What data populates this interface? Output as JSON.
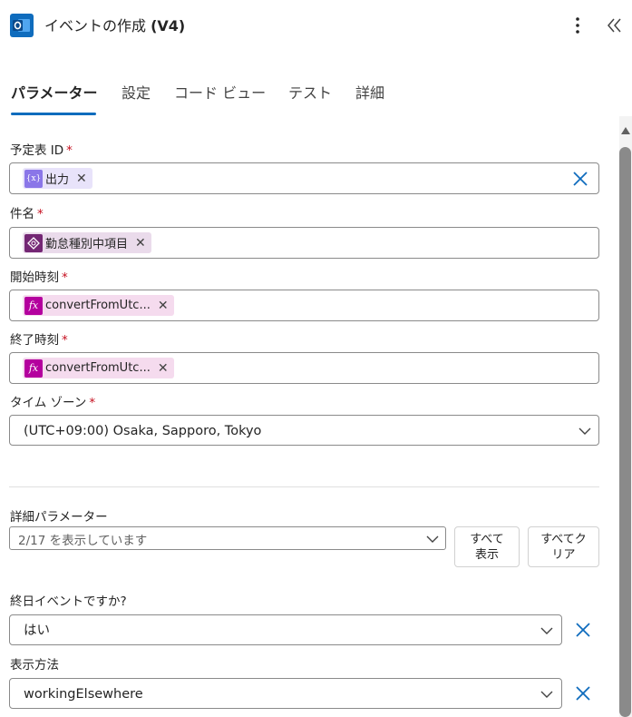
{
  "header": {
    "title_prefix": "イベントの作成 ",
    "title_version": "(V4)",
    "app_icon": "outlook-icon",
    "more_icon": "more-vertical-icon",
    "collapse_icon": "chevron-double-left-icon"
  },
  "tabs": [
    {
      "label": "パラメーター",
      "active": true
    },
    {
      "label": "設定",
      "active": false
    },
    {
      "label": "コード ビュー",
      "active": false
    },
    {
      "label": "テスト",
      "active": false
    },
    {
      "label": "詳細",
      "active": false
    }
  ],
  "fields": {
    "calendar_id": {
      "label": "予定表 ID",
      "required": "*",
      "token": "出力",
      "token_icon": "expression-variable-icon"
    },
    "subject": {
      "label": "件名",
      "required": "*",
      "token": "勤怠種別中項目",
      "token_icon": "power-apps-icon"
    },
    "start_time": {
      "label": "開始時刻",
      "required": "*",
      "token": "convertFromUtc...",
      "token_icon": "function-fx-icon"
    },
    "end_time": {
      "label": "終了時刻",
      "required": "*",
      "token": "convertFromUtc...",
      "token_icon": "function-fx-icon"
    },
    "time_zone": {
      "label": "タイム ゾーン",
      "required": "*",
      "value": "(UTC+09:00) Osaka, Sapporo, Tokyo"
    }
  },
  "advanced": {
    "label": "詳細パラメーター",
    "select_value": "2/17 を表示しています",
    "show_all_label": "すべて\n表示",
    "clear_all_label": "すべてク\nリア"
  },
  "all_day": {
    "label": "終日イベントですか?",
    "value": "はい"
  },
  "show_as": {
    "label": "表示方法",
    "value": "workingElsewhere"
  },
  "colors": {
    "accent": "#0f6cbd",
    "required": "#c50f1f",
    "token_variable": "#8a76e8",
    "token_powerapps": "#742774",
    "token_function": "#b4009e"
  }
}
